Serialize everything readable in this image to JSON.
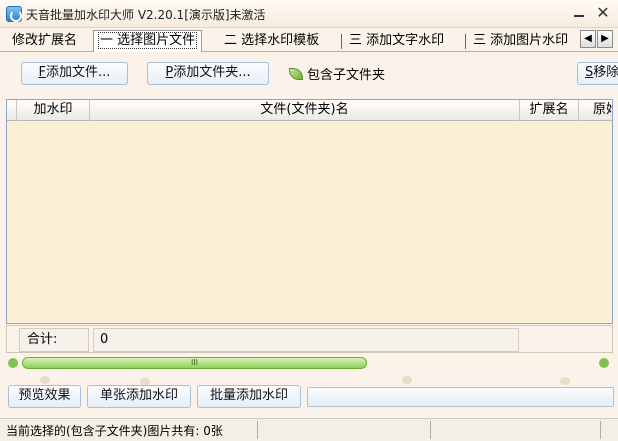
{
  "window": {
    "title": "天音批量加水印大师 V2.20.1[演示版]未激活",
    "minimize_label": "",
    "close_label": "✕"
  },
  "tabs": [
    {
      "label": "修改扩展名"
    },
    {
      "label": "一 选择图片文件"
    },
    {
      "label": "二 选择水印模板"
    },
    {
      "label": "三 添加文字水印"
    },
    {
      "label": "三 添加图片水印"
    }
  ],
  "tab_scroll": {
    "left": "◀",
    "right": "▶"
  },
  "toolbar": {
    "add_file_hotkey": "F",
    "add_file_label": "添加文件...",
    "add_folder_hotkey": "P",
    "add_folder_label": "添加文件夹...",
    "include_subfolders_label": "包含子文件夹",
    "remove_hotkey": "S",
    "remove_label": "移除"
  },
  "table": {
    "columns": [
      "加水印",
      "文件(文件夹)名",
      "扩展名",
      "原始"
    ],
    "rows": []
  },
  "total": {
    "label": "合计:",
    "value": "0"
  },
  "scrollbar": {
    "thumb_grip": "III"
  },
  "actions": {
    "preview_label": "预览效果",
    "single_label": "单张添加水印",
    "batch_label": "批量添加水印"
  },
  "status": {
    "text": "当前选择的(包含子文件夹)图片共有: 0张"
  },
  "colors": {
    "accent": "#8ed05a",
    "table_bg": "#fbefd6",
    "window_bg": "#fbf3ea"
  }
}
